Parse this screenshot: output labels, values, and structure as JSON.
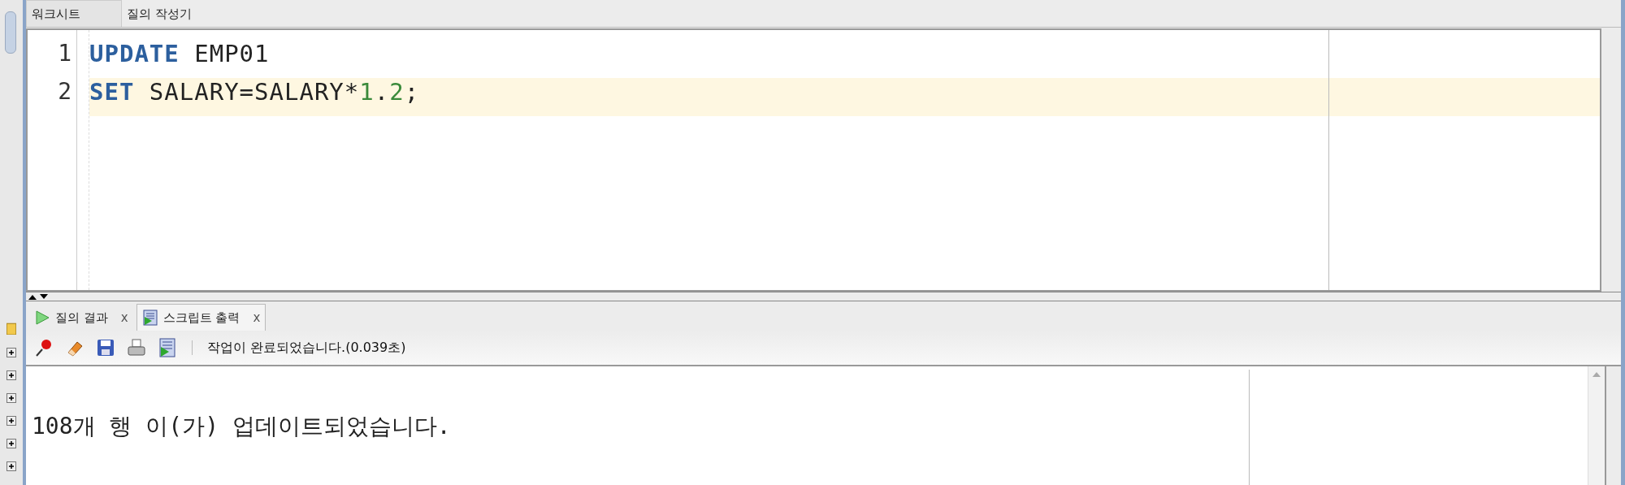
{
  "top_tabs": [
    {
      "label": "워크시트",
      "selected": true
    },
    {
      "label": "질의 작성기",
      "selected": false
    }
  ],
  "editor": {
    "lines": [
      {
        "number": "1",
        "current": false,
        "tokens": [
          {
            "kind": "keyword",
            "text": "UPDATE"
          },
          {
            "kind": "plain",
            "text": " EMP01"
          }
        ]
      },
      {
        "number": "2",
        "current": true,
        "tokens": [
          {
            "kind": "keyword",
            "text": "SET"
          },
          {
            "kind": "plain",
            "text": " SALARY=SALARY*"
          },
          {
            "kind": "number",
            "text": "1"
          },
          {
            "kind": "plain",
            "text": "."
          },
          {
            "kind": "number",
            "text": "2"
          },
          {
            "kind": "plain",
            "text": ";"
          }
        ]
      }
    ]
  },
  "bottom_tabs": [
    {
      "label": "질의 결과",
      "kind": "run",
      "selected": false,
      "close": "x"
    },
    {
      "label": "스크립트 출력",
      "kind": "script",
      "selected": true,
      "close": "x"
    }
  ],
  "toolbar": {
    "tools": [
      {
        "kind": "pin"
      },
      {
        "kind": "eraser"
      },
      {
        "kind": "save"
      },
      {
        "kind": "print"
      },
      {
        "kind": "script"
      }
    ],
    "status": "작업이 완료되었습니다.(0.039초)"
  },
  "output": {
    "text": "108개 행 이(가) 업데이트되었습니다."
  }
}
